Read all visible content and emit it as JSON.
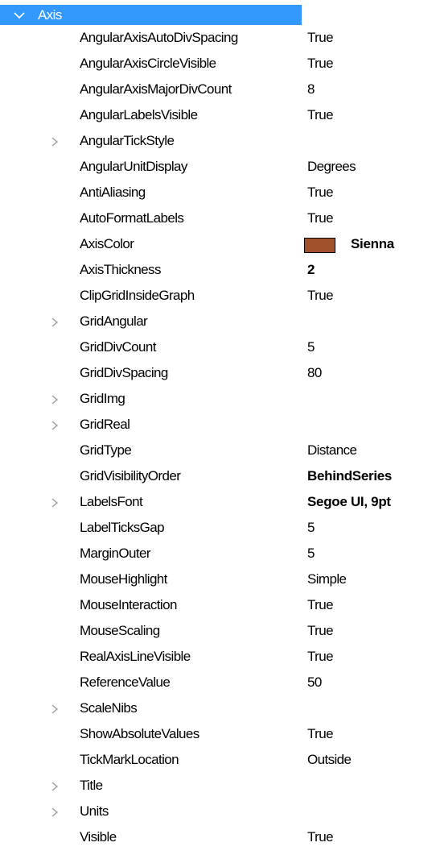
{
  "category": {
    "label": "Axis",
    "colors": {
      "highlight": "#3399ff",
      "highlight_text": "#ffffff"
    }
  },
  "properties": [
    {
      "name": "AngularAxisAutoDivSpacing",
      "value": "True",
      "expandable": false,
      "bold": false
    },
    {
      "name": "AngularAxisCircleVisible",
      "value": "True",
      "expandable": false,
      "bold": false
    },
    {
      "name": "AngularAxisMajorDivCount",
      "value": "8",
      "expandable": false,
      "bold": false
    },
    {
      "name": "AngularLabelsVisible",
      "value": "True",
      "expandable": false,
      "bold": false
    },
    {
      "name": "AngularTickStyle",
      "value": "",
      "expandable": true,
      "bold": false
    },
    {
      "name": "AngularUnitDisplay",
      "value": "Degrees",
      "expandable": false,
      "bold": false
    },
    {
      "name": "AntiAliasing",
      "value": "True",
      "expandable": false,
      "bold": false
    },
    {
      "name": "AutoFormatLabels",
      "value": "True",
      "expandable": false,
      "bold": false
    },
    {
      "name": "AxisColor",
      "value": "Sienna",
      "expandable": false,
      "bold": true,
      "swatch": "#a0522d"
    },
    {
      "name": "AxisThickness",
      "value": "2",
      "expandable": false,
      "bold": true
    },
    {
      "name": "ClipGridInsideGraph",
      "value": "True",
      "expandable": false,
      "bold": false
    },
    {
      "name": "GridAngular",
      "value": "",
      "expandable": true,
      "bold": false
    },
    {
      "name": "GridDivCount",
      "value": "5",
      "expandable": false,
      "bold": false
    },
    {
      "name": "GridDivSpacing",
      "value": "80",
      "expandable": false,
      "bold": false
    },
    {
      "name": "GridImg",
      "value": "",
      "expandable": true,
      "bold": false
    },
    {
      "name": "GridReal",
      "value": "",
      "expandable": true,
      "bold": false
    },
    {
      "name": "GridType",
      "value": "Distance",
      "expandable": false,
      "bold": false
    },
    {
      "name": "GridVisibilityOrder",
      "value": "BehindSeries",
      "expandable": false,
      "bold": true
    },
    {
      "name": "LabelsFont",
      "value": "Segoe UI, 9pt",
      "expandable": true,
      "bold": true
    },
    {
      "name": "LabelTicksGap",
      "value": "5",
      "expandable": false,
      "bold": false
    },
    {
      "name": "MarginOuter",
      "value": "5",
      "expandable": false,
      "bold": false
    },
    {
      "name": "MouseHighlight",
      "value": "Simple",
      "expandable": false,
      "bold": false
    },
    {
      "name": "MouseInteraction",
      "value": "True",
      "expandable": false,
      "bold": false
    },
    {
      "name": "MouseScaling",
      "value": "True",
      "expandable": false,
      "bold": false
    },
    {
      "name": "RealAxisLineVisible",
      "value": "True",
      "expandable": false,
      "bold": false
    },
    {
      "name": "ReferenceValue",
      "value": "50",
      "expandable": false,
      "bold": false
    },
    {
      "name": "ScaleNibs",
      "value": "",
      "expandable": true,
      "bold": false
    },
    {
      "name": "ShowAbsoluteValues",
      "value": "True",
      "expandable": false,
      "bold": false
    },
    {
      "name": "TickMarkLocation",
      "value": "Outside",
      "expandable": false,
      "bold": false
    },
    {
      "name": "Title",
      "value": "",
      "expandable": true,
      "bold": false
    },
    {
      "name": "Units",
      "value": "",
      "expandable": true,
      "bold": false
    },
    {
      "name": "Visible",
      "value": "True",
      "expandable": false,
      "bold": false
    }
  ]
}
